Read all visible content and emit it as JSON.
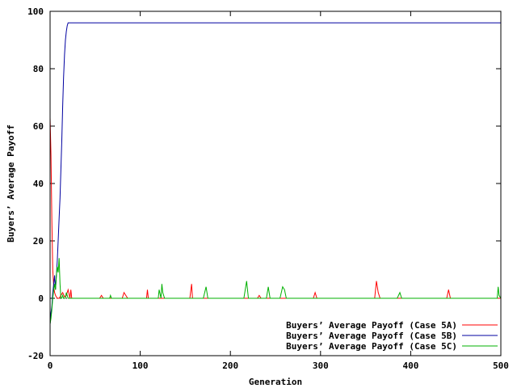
{
  "chart_data": {
    "type": "line",
    "xlabel": "Generation",
    "ylabel": "Buyers’ Average Payoff",
    "xlim": [
      0,
      500
    ],
    "ylim": [
      -20,
      100
    ],
    "xticks": [
      0,
      100,
      200,
      300,
      400,
      500
    ],
    "yticks": [
      -20,
      0,
      20,
      40,
      60,
      80,
      100
    ],
    "grid": false,
    "legend_position": "bottom-right",
    "zero_line": true,
    "series": [
      {
        "name": "Buyers’ Average Payoff  (Case 5A)",
        "color": "#ff0000",
        "x": [
          0,
          1,
          2,
          3,
          4,
          5,
          6,
          7,
          8,
          10,
          12,
          14,
          16,
          18,
          20,
          22,
          23,
          24,
          26,
          30,
          40,
          55,
          57,
          59,
          80,
          82,
          84,
          86,
          100,
          107,
          108,
          109,
          120,
          155,
          157,
          158,
          160,
          200,
          230,
          232,
          234,
          260,
          292,
          294,
          296,
          340,
          360,
          362,
          364,
          366,
          400,
          440,
          442,
          444,
          470,
          496,
          498,
          500
        ],
        "y": [
          63,
          50,
          27,
          10,
          4,
          2,
          1,
          0.5,
          0,
          0,
          1,
          2,
          0.5,
          1,
          3,
          0,
          3,
          0,
          0,
          0,
          0,
          0,
          1,
          0,
          0,
          2,
          1,
          0,
          0,
          0,
          3,
          0,
          0,
          0,
          5,
          0,
          0,
          0,
          0,
          1,
          0,
          0,
          0,
          2,
          0,
          0,
          0,
          6,
          2,
          0,
          0,
          0,
          3,
          0,
          0,
          0,
          0,
          0
        ]
      },
      {
        "name": "Buyers’ Average Payoff  (Case 5B)",
        "color": "#0000a0",
        "x": [
          0,
          1,
          2,
          3,
          4,
          5,
          6,
          7,
          8,
          9,
          10,
          11,
          12,
          13,
          14,
          15,
          16,
          17,
          18,
          19,
          20,
          22,
          25,
          50,
          100,
          150,
          200,
          250,
          300,
          350,
          400,
          450,
          500
        ],
        "y": [
          -9,
          -5,
          -3,
          2,
          5,
          8,
          3,
          8,
          13,
          20,
          28,
          35,
          45,
          55,
          67,
          77,
          85,
          90,
          93,
          95,
          96,
          96,
          96,
          96,
          96,
          96,
          96,
          96,
          96,
          96,
          96,
          96,
          96
        ]
      },
      {
        "name": "Buyers’ Average Payoff  (Case 5C)",
        "color": "#00b000",
        "x": [
          0,
          1,
          2,
          3,
          4,
          5,
          6,
          7,
          8,
          9,
          10,
          11,
          12,
          13,
          14,
          15,
          16,
          17,
          18,
          19,
          20,
          21,
          40,
          66,
          67,
          68,
          120,
          121,
          123,
          124,
          125,
          127,
          150,
          170,
          173,
          175,
          215,
          218,
          220,
          240,
          242,
          244,
          255,
          258,
          260,
          262,
          300,
          385,
          388,
          390,
          440,
          496,
          497,
          498,
          500
        ],
        "y": [
          -9,
          -7,
          -4,
          0,
          3,
          5,
          3,
          8,
          11,
          9,
          14,
          5,
          0,
          0,
          1,
          0,
          0,
          0,
          2,
          1,
          0,
          0,
          0,
          0,
          1,
          0,
          0,
          3,
          0,
          5,
          2,
          0,
          0,
          0,
          4,
          0,
          0,
          6,
          0,
          0,
          4,
          0,
          0,
          4,
          3,
          0,
          0,
          0,
          2,
          0,
          0,
          0,
          4,
          1,
          0
        ]
      }
    ]
  }
}
